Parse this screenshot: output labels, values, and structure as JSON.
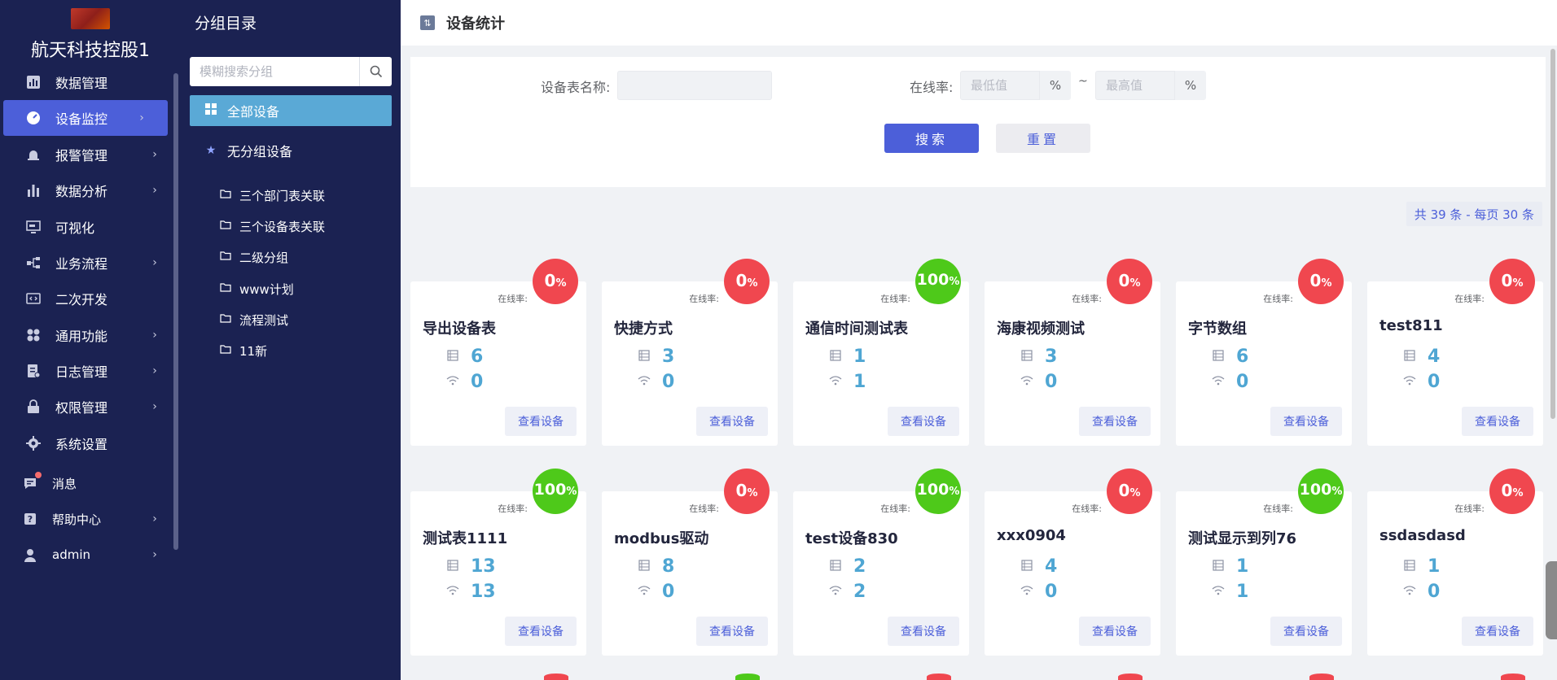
{
  "brand": {
    "name": "航天科技控股1"
  },
  "nav": [
    {
      "label": "数据管理",
      "icon": "bar-chart-icon",
      "arrow": false,
      "active": false
    },
    {
      "label": "设备监控",
      "icon": "dashboard-icon",
      "arrow": true,
      "active": true
    },
    {
      "label": "报警管理",
      "icon": "alarm-icon",
      "arrow": true,
      "active": false
    },
    {
      "label": "数据分析",
      "icon": "analytics-icon",
      "arrow": true,
      "active": false
    },
    {
      "label": "可视化",
      "icon": "monitor-icon",
      "arrow": false,
      "active": false
    },
    {
      "label": "业务流程",
      "icon": "flow-icon",
      "arrow": true,
      "active": false
    },
    {
      "label": "二次开发",
      "icon": "code-icon",
      "arrow": false,
      "active": false
    },
    {
      "label": "通用功能",
      "icon": "grid-icon",
      "arrow": true,
      "active": false
    },
    {
      "label": "日志管理",
      "icon": "log-icon",
      "arrow": true,
      "active": false
    },
    {
      "label": "权限管理",
      "icon": "lock-icon",
      "arrow": true,
      "active": false
    },
    {
      "label": "系统设置",
      "icon": "gear-icon",
      "arrow": false,
      "active": false
    }
  ],
  "nav_bottom": [
    {
      "label": "消息",
      "icon": "message-icon",
      "arrow": false
    },
    {
      "label": "帮助中心",
      "icon": "help-icon",
      "arrow": true
    },
    {
      "label": "admin",
      "icon": "user-icon",
      "arrow": true
    }
  ],
  "groups": {
    "title": "分组目录",
    "search_placeholder": "模糊搜索分组",
    "all_label": "全部设备",
    "nogroup_label": "无分组设备",
    "folders": [
      "三个部门表关联",
      "三个设备表关联",
      "二级分组",
      "www计划",
      "流程测试",
      "11新"
    ]
  },
  "header": {
    "title": "设备统计"
  },
  "filter": {
    "name_label": "设备表名称:",
    "rate_label": "在线率:",
    "min_placeholder": "最低值",
    "max_placeholder": "最高值",
    "pct": "%",
    "tilde": "~",
    "search_label": "搜索",
    "reset_label": "重置"
  },
  "pager": {
    "text": "共 39 条 - 每页 30 条"
  },
  "card_common": {
    "rate_label": "在线率:",
    "view_label": "查看设备",
    "pct": "%"
  },
  "cards": [
    {
      "name": "导出设备表",
      "rate": 0,
      "total": 6,
      "online": 0
    },
    {
      "name": "快捷方式",
      "rate": 0,
      "total": 3,
      "online": 0
    },
    {
      "name": "通信时间测试表",
      "rate": 100,
      "total": 1,
      "online": 1
    },
    {
      "name": "海康视频测试",
      "rate": 0,
      "total": 3,
      "online": 0
    },
    {
      "name": "字节数组",
      "rate": 0,
      "total": 6,
      "online": 0
    },
    {
      "name": "test811",
      "rate": 0,
      "total": 4,
      "online": 0
    },
    {
      "name": "测试表1111",
      "rate": 100,
      "total": 13,
      "online": 13
    },
    {
      "name": "modbus驱动",
      "rate": 0,
      "total": 8,
      "online": 0
    },
    {
      "name": "test设备830",
      "rate": 100,
      "total": 2,
      "online": 2
    },
    {
      "name": "xxx0904",
      "rate": 0,
      "total": 4,
      "online": 0
    },
    {
      "name": "测试显示到列76",
      "rate": 100,
      "total": 1,
      "online": 1
    },
    {
      "name": "ssdasdasd",
      "rate": 0,
      "total": 1,
      "online": 0
    }
  ],
  "peek_badges": [
    "red",
    "green",
    "red",
    "red",
    "red",
    "red"
  ],
  "colors": {
    "sidebar": "#1b2252",
    "accent": "#4c5fd9",
    "group_active": "#5aa9d6",
    "badge_red": "#f0474f",
    "badge_green": "#4ec91a",
    "value": "#4fa6d3"
  }
}
